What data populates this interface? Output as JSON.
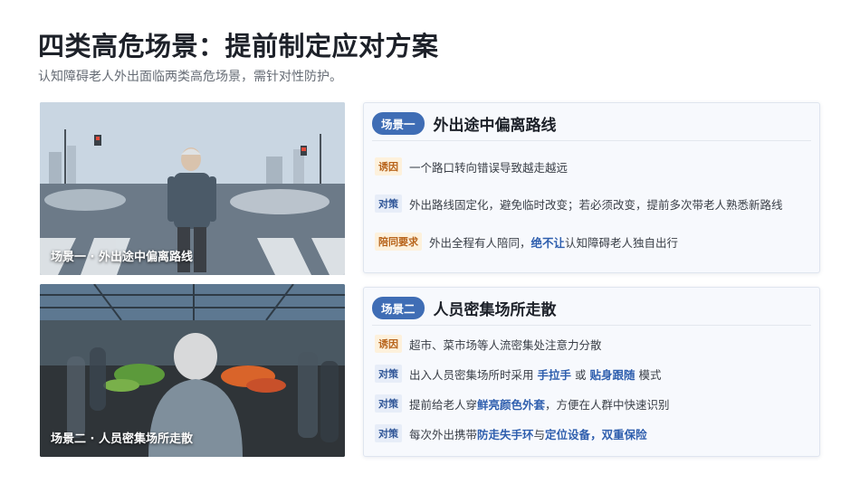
{
  "header": {
    "title": "四类高危场景：提前制定应对方案",
    "subtitle": "认知障碍老人外出面临两类高危场景，需针对性防护。"
  },
  "photos": [
    {
      "caption": "场景一 · 外出途中偏离路线"
    },
    {
      "caption": "场景二 · 人员密集场所走散"
    }
  ],
  "scenario1": {
    "pill": "场景一",
    "title": "外出途中偏离路线",
    "cause_tag": "诱因",
    "cause_text": "一个路口转向错误导致越走越远",
    "plan_tag": "对策",
    "plan_text": "外出路线固定化，避免临时改变；若必须改变，提前多次带老人熟悉新路线",
    "escort_tag": "陪同要求",
    "escort_pre": "外出全程有人陪同，",
    "escort_hl": "绝不让",
    "escort_post": "认知障碍老人独自出行"
  },
  "scenario2": {
    "pill": "场景二",
    "title": "人员密集场所走散",
    "cause_tag": "诱因",
    "cause_text": "超市、菜市场等人流密集处注意力分散",
    "plan1_tag": "对策",
    "plan1_pre": "出入人员密集场所时采用 ",
    "plan1_hl1": "手拉手",
    "plan1_mid": " 或 ",
    "plan1_hl2": "贴身跟随",
    "plan1_post": " 模式",
    "plan2_tag": "对策",
    "plan2_pre": "提前给老人穿",
    "plan2_hl": "鲜亮颜色外套",
    "plan2_post": "，方便在人群中快速识别",
    "plan3_tag": "对策",
    "plan3_pre": "每次外出携带",
    "plan3_hl1": "防走失手环",
    "plan3_mid": "与",
    "plan3_hl2": "定位设备",
    "plan3_sep": "，",
    "plan3_hl3": "双重保险"
  },
  "colors": {
    "accent": "#3f6db5",
    "highlight": "#2f5fae",
    "cause_tag": "#b8641b",
    "plan_tag": "#2f5597"
  }
}
